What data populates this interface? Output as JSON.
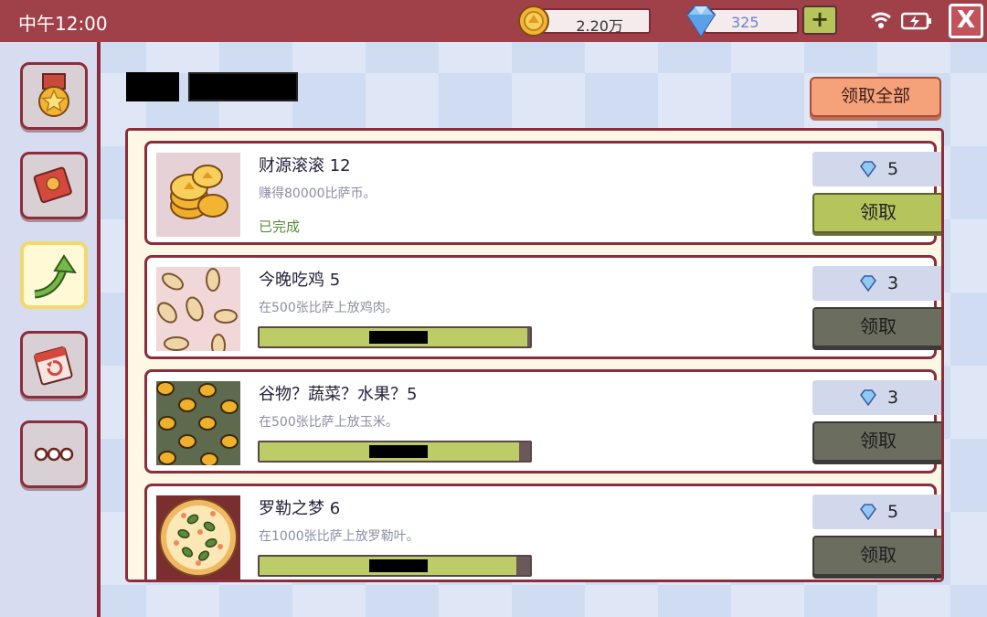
{
  "status_bar": {
    "time": "中午12:00",
    "coins": "2.20万",
    "gems": "325",
    "plus_label": "+",
    "close_label": "X"
  },
  "header": {
    "title": "",
    "subtitle": "",
    "claim_all_label": "领取全部"
  },
  "sidebar": {
    "items": [
      {
        "icon": "medal-icon"
      },
      {
        "icon": "recipe-book-icon"
      },
      {
        "icon": "arrow-up-icon",
        "active": true
      },
      {
        "icon": "calendar-icon"
      },
      {
        "icon": "more-icon"
      }
    ]
  },
  "achievements": [
    {
      "title": "财源滚滚  12",
      "description": "赚得80000比萨币。",
      "status": "已完成",
      "progress": 1.0,
      "progress_label": "",
      "reward": "5",
      "claim_label": "领取",
      "claimable": true,
      "icon": "coins-icon"
    },
    {
      "title": "今晚吃鸡  5",
      "description": "在500张比萨上放鸡肉。",
      "status": "",
      "progress": 0.99,
      "progress_label": "",
      "reward": "3",
      "claim_label": "领取",
      "claimable": false,
      "icon": "chicken-icon"
    },
    {
      "title": "谷物？蔬菜？水果？5",
      "description": "在500张比萨上放玉米。",
      "status": "",
      "progress": 0.96,
      "progress_label": "",
      "reward": "3",
      "claim_label": "领取",
      "claimable": false,
      "icon": "corn-icon"
    },
    {
      "title": "罗勒之梦  6",
      "description": "在1000张比萨上放罗勒叶。",
      "status": "",
      "progress": 0.95,
      "progress_label": "",
      "reward": "5",
      "claim_label": "领取",
      "claimable": false,
      "icon": "basil-pizza-icon"
    }
  ]
}
